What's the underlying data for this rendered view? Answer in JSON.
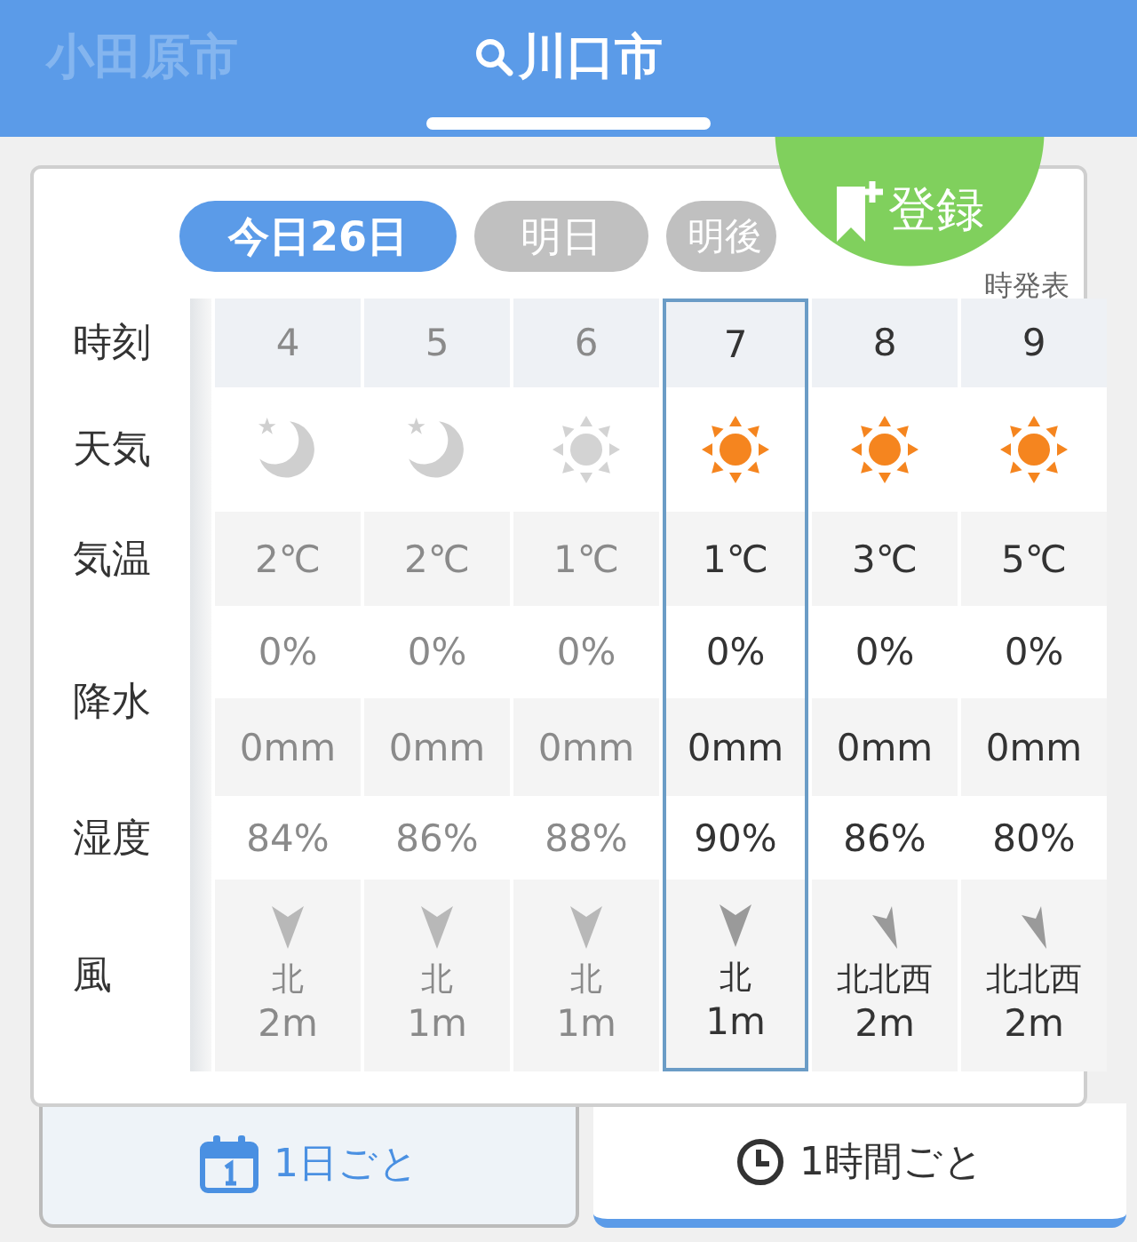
{
  "city_tabs": [
    {
      "label": "小田原市",
      "selected": false,
      "kind": "plain"
    },
    {
      "label": "川口市",
      "selected": true,
      "kind": "search"
    }
  ],
  "register_button": {
    "label": "登録"
  },
  "day_tabs": [
    {
      "label": "今日26日",
      "selected": true
    },
    {
      "label": "明日",
      "selected": false
    },
    {
      "label": "明後",
      "selected": false
    }
  ],
  "issued": "時発表",
  "row_labels": {
    "hour": "時刻",
    "weather": "天気",
    "temp": "気温",
    "precip": "降水",
    "humidity": "湿度",
    "wind": "風"
  },
  "hours": [
    {
      "hour": "4",
      "weather": {
        "kind": "moon"
      },
      "temp": "2℃",
      "precip": "0%",
      "rain": "0mm",
      "humidity": "84%",
      "wind": {
        "kind": "down",
        "direction": "北",
        "speed": "2m"
      },
      "past": true,
      "selected": false
    },
    {
      "hour": "5",
      "weather": {
        "kind": "moon"
      },
      "temp": "2℃",
      "precip": "0%",
      "rain": "0mm",
      "humidity": "86%",
      "wind": {
        "kind": "down",
        "direction": "北",
        "speed": "1m"
      },
      "past": true,
      "selected": false
    },
    {
      "hour": "6",
      "weather": {
        "kind": "sun"
      },
      "temp": "1℃",
      "precip": "0%",
      "rain": "0mm",
      "humidity": "88%",
      "wind": {
        "kind": "down",
        "direction": "北",
        "speed": "1m"
      },
      "past": true,
      "selected": false
    },
    {
      "hour": "7",
      "weather": {
        "kind": "sun"
      },
      "temp": "1℃",
      "precip": "0%",
      "rain": "0mm",
      "humidity": "90%",
      "wind": {
        "kind": "down",
        "direction": "北",
        "speed": "1m"
      },
      "past": false,
      "selected": true
    },
    {
      "hour": "8",
      "weather": {
        "kind": "sun"
      },
      "temp": "3℃",
      "precip": "0%",
      "rain": "0mm",
      "humidity": "86%",
      "wind": {
        "kind": "tilted",
        "direction": "北北西",
        "speed": "2m"
      },
      "past": false,
      "selected": false
    },
    {
      "hour": "9",
      "weather": {
        "kind": "sun"
      },
      "temp": "5℃",
      "precip": "0%",
      "rain": "0mm",
      "humidity": "80%",
      "wind": {
        "kind": "tilted",
        "direction": "北北西",
        "speed": "2m"
      },
      "past": false,
      "selected": false
    }
  ],
  "view_tabs": [
    {
      "label": "1日ごと",
      "kind": "calendar",
      "selected": false
    },
    {
      "label": "1時間ごと",
      "kind": "clock",
      "selected": true
    }
  ]
}
